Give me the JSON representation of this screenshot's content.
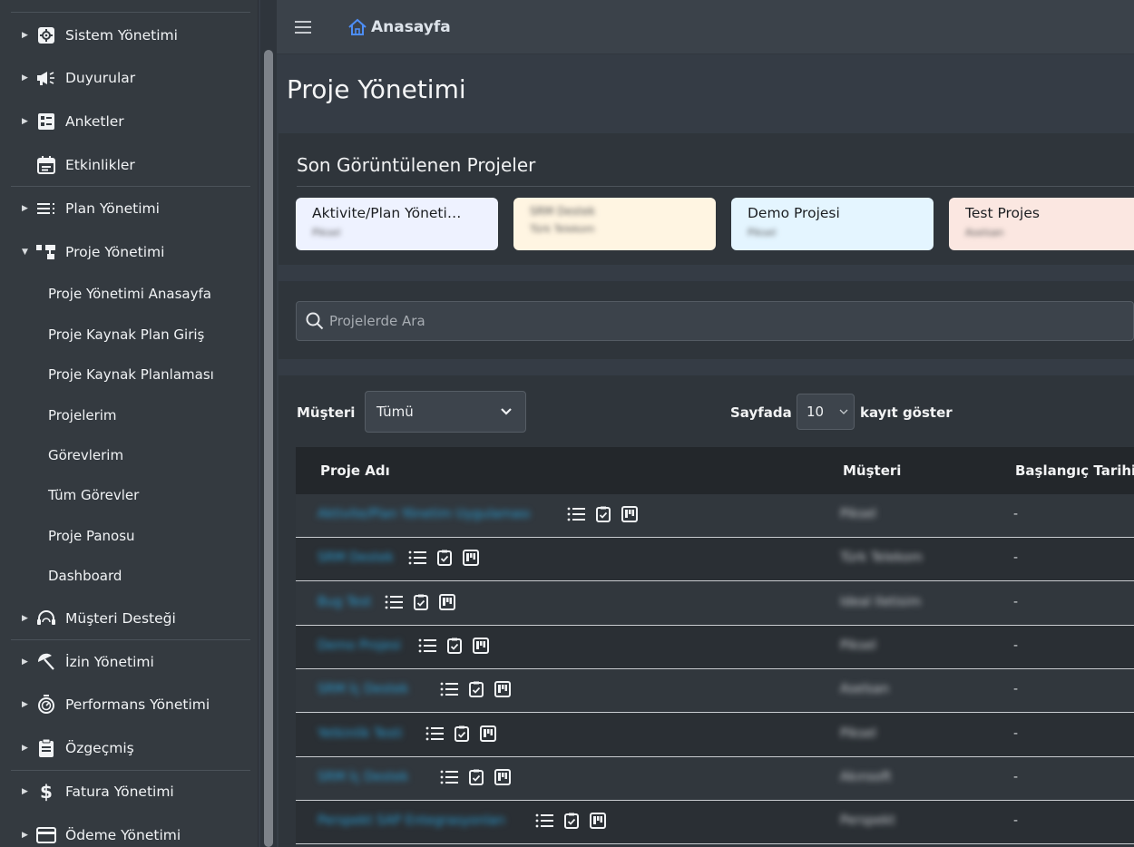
{
  "sidebar": {
    "items": [
      {
        "label": "Sistem Yönetimi",
        "icon": "gear-icon"
      },
      {
        "label": "Duyurular",
        "icon": "megaphone-icon"
      },
      {
        "label": "Anketler",
        "icon": "survey-icon"
      },
      {
        "label": "Etkinlikler",
        "icon": "calendar-icon"
      },
      {
        "label": "Plan Yönetimi",
        "icon": "list-icon"
      },
      {
        "label": "Proje Yönetimi",
        "icon": "project-tree-icon"
      },
      {
        "label": "Müşteri Desteği",
        "icon": "headset-icon"
      },
      {
        "label": "İzin Yönetimi",
        "icon": "beach-umbrella-icon"
      },
      {
        "label": "Performans Yönetimi",
        "icon": "stopwatch-icon"
      },
      {
        "label": "Özgeçmiş",
        "icon": "clipboard-icon"
      },
      {
        "label": "Fatura Yönetimi",
        "icon": "dollar-icon"
      },
      {
        "label": "Ödeme Yönetimi",
        "icon": "credit-card-icon"
      }
    ],
    "project_sub": [
      "Proje Yönetimi Anasayfa",
      "Proje Kaynak Plan Giriş",
      "Proje Kaynak Planlaması",
      "Projelerim",
      "Görevlerim",
      "Tüm Görevler",
      "Proje Panosu",
      "Dashboard"
    ]
  },
  "header": {
    "home_label": "Anasayfa"
  },
  "page_title": "Proje Yönetimi",
  "recent": {
    "title": "Son Görüntülenen Projeler",
    "cards": [
      {
        "title": "Aktivite/Plan Yöneti…",
        "sub": "Piksel",
        "color": "#eef2ff"
      },
      {
        "title": "SRM Destek",
        "sub": "Türk Telekom",
        "color": "#fff5e2"
      },
      {
        "title": "Demo Projesi",
        "sub": "Piksel",
        "color": "#e4f5ff"
      },
      {
        "title": "Test Projes",
        "sub": "Aselsan",
        "color": "#fbe7e1"
      }
    ]
  },
  "search": {
    "placeholder": "Projelerde Ara"
  },
  "filters": {
    "customer_label": "Müşteri",
    "customer_value": "Tümü",
    "length_prefix": "Sayfada",
    "length_value": "10",
    "length_suffix": "kayıt göster"
  },
  "table": {
    "headers": {
      "name": "Proje Adı",
      "customer": "Müşteri",
      "start": "Başlangıç Tarihi"
    },
    "rows": [
      {
        "name": "Aktivite/Plan Yönetim Uygulaması",
        "customer": "Piksel",
        "start": "-"
      },
      {
        "name": "SRM Destek",
        "customer": "Türk Telekom",
        "start": "-"
      },
      {
        "name": "Bug Test",
        "customer": "Ideal Iletisim",
        "start": "-"
      },
      {
        "name": "Demo Projesi",
        "customer": "Piksel",
        "start": "-"
      },
      {
        "name": "SRM İç Destek",
        "customer": "Aselsan",
        "start": "-"
      },
      {
        "name": "Yetkinlik Testi",
        "customer": "Piksel",
        "start": "-"
      },
      {
        "name": "SRM İç Destek",
        "customer": "Akınsoft",
        "start": "-"
      },
      {
        "name": "Perspekt SAP Entegrasyonları",
        "customer": "Perspekt",
        "start": "-"
      }
    ]
  }
}
